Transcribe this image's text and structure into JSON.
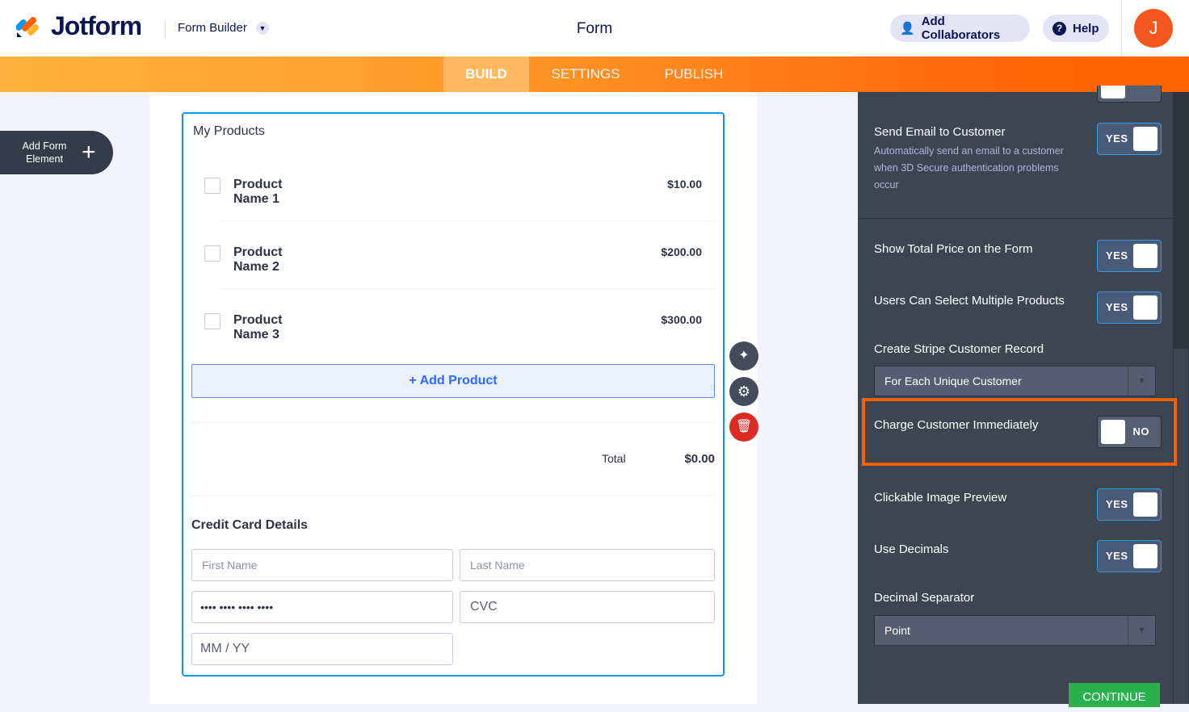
{
  "header": {
    "brand": "Jotform",
    "product_switcher": "Form Builder",
    "title": "Form",
    "add_collaborators": "Add Collaborators",
    "help": "Help",
    "avatar_initial": "J"
  },
  "nav": {
    "tabs": [
      "BUILD",
      "SETTINGS",
      "PUBLISH"
    ],
    "active": "BUILD"
  },
  "sidebar": {
    "add_form_element": "Add Form Element"
  },
  "form": {
    "products_label": "My Products",
    "products": [
      {
        "name": "Product Name 1",
        "price": "$10.00"
      },
      {
        "name": "Product Name 2",
        "price": "$200.00"
      },
      {
        "name": "Product Name 3",
        "price": "$300.00"
      }
    ],
    "add_product": "+ Add Product",
    "total_label": "Total",
    "total_value": "$0.00",
    "cc_title": "Credit Card Details",
    "first_name_placeholder": "First Name",
    "last_name_placeholder": "Last Name",
    "card_number": "•••• •••• •••• ••••",
    "cvc": "CVC",
    "expiry": "MM / YY"
  },
  "panel": {
    "send_email": {
      "label": "Send Email to Customer",
      "desc": "Automatically send an email to a customer when 3D Secure authentication problems occur",
      "value": "YES"
    },
    "show_total": {
      "label": "Show Total Price on the Form",
      "value": "YES"
    },
    "multi_select": {
      "label": "Users Can Select Multiple Products",
      "value": "YES"
    },
    "stripe_record": {
      "label": "Create Stripe Customer Record",
      "value": "For Each Unique Customer"
    },
    "charge_immediately": {
      "label": "Charge Customer Immediately",
      "value": "NO"
    },
    "image_preview": {
      "label": "Clickable Image Preview",
      "value": "YES"
    },
    "use_decimals": {
      "label": "Use Decimals",
      "value": "YES"
    },
    "decimal_separator": {
      "label": "Decimal Separator",
      "value": "Point"
    },
    "continue": "CONTINUE"
  },
  "colors": {
    "accent": "#ff6100",
    "brand_navy": "#0a1551",
    "link_blue": "#2e69ff",
    "panel_bg": "#3e4552",
    "continue_green": "#29b14c"
  }
}
